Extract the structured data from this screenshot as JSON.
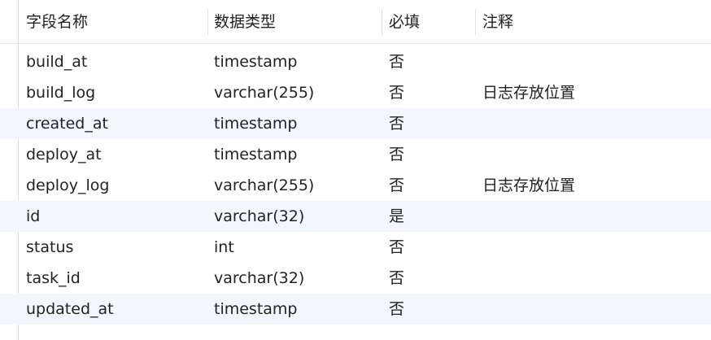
{
  "columns": {
    "name": "字段名称",
    "type": "数据类型",
    "required": "必填",
    "comment": "注释"
  },
  "rows": [
    {
      "name": "build_at",
      "type": "timestamp",
      "required": "否",
      "comment": ""
    },
    {
      "name": "build_log",
      "type": "varchar(255)",
      "required": "否",
      "comment": "日志存放位置"
    },
    {
      "name": "created_at",
      "type": "timestamp",
      "required": "否",
      "comment": ""
    },
    {
      "name": "deploy_at",
      "type": "timestamp",
      "required": "否",
      "comment": ""
    },
    {
      "name": "deploy_log",
      "type": "varchar(255)",
      "required": "否",
      "comment": "日志存放位置"
    },
    {
      "name": "id",
      "type": "varchar(32)",
      "required": "是",
      "comment": ""
    },
    {
      "name": "status",
      "type": "int",
      "required": "否",
      "comment": ""
    },
    {
      "name": "task_id",
      "type": "varchar(32)",
      "required": "否",
      "comment": ""
    },
    {
      "name": "updated_at",
      "type": "timestamp",
      "required": "否",
      "comment": ""
    }
  ],
  "colors": {
    "alt_row": "#f3f7fc",
    "divider": "#e3e3e3"
  }
}
